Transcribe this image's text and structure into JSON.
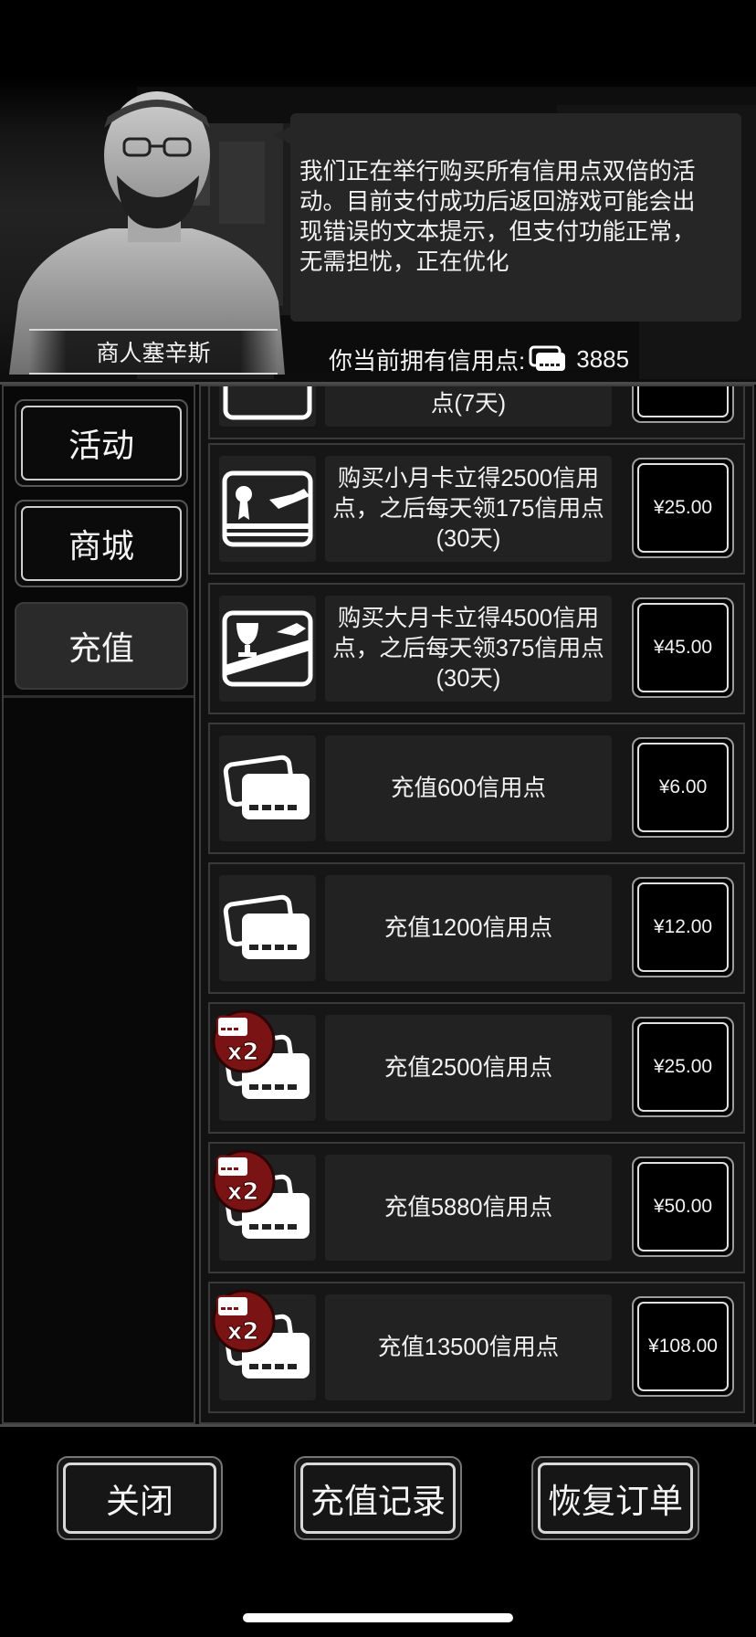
{
  "header": {
    "npc_name": "商人塞辛斯",
    "message_lines": [
      "我们正在举行购买所有信用点双倍的活",
      "动。目前支付成功后返回游戏可能会出",
      "现错误的文本提示，但支付功能正常，",
      "无需担忧，正在优化"
    ],
    "credits_label": "你当前拥有信用点:",
    "credits_value": "3885"
  },
  "tabs": [
    {
      "label": "活动",
      "active": false
    },
    {
      "label": "商城",
      "active": false
    },
    {
      "label": "充值",
      "active": true
    }
  ],
  "shop_items": [
    {
      "desc": "点(7天)",
      "price": "",
      "icon": "ticket-card-icon",
      "double": false,
      "partial": true
    },
    {
      "desc": "购买小月卡立得2500信用点，之后每天领175信用点(30天)",
      "price": "¥25.00",
      "icon": "small-monthly-card-icon",
      "double": false
    },
    {
      "desc": "购买大月卡立得4500信用点，之后每天领375信用点(30天)",
      "price": "¥45.00",
      "icon": "large-monthly-card-icon",
      "double": false
    },
    {
      "desc": "充值600信用点",
      "price": "¥6.00",
      "icon": "credit-cards-icon",
      "double": false
    },
    {
      "desc": "充值1200信用点",
      "price": "¥12.00",
      "icon": "credit-cards-icon",
      "double": false
    },
    {
      "desc": "充值2500信用点",
      "price": "¥25.00",
      "icon": "credit-cards-icon",
      "double": true,
      "badge": "x2"
    },
    {
      "desc": "充值5880信用点",
      "price": "¥50.00",
      "icon": "credit-cards-icon",
      "double": true,
      "badge": "x2"
    },
    {
      "desc": "充值13500信用点",
      "price": "¥108.00",
      "icon": "credit-cards-icon",
      "double": true,
      "badge": "x2"
    }
  ],
  "bottom": {
    "close": "关闭",
    "history": "充值记录",
    "restore": "恢复订单"
  }
}
